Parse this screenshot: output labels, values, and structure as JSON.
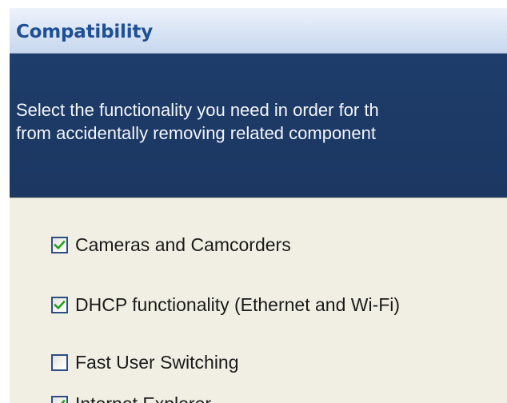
{
  "window": {
    "title": "Compatibility"
  },
  "banner": {
    "line1": "Select the functionality you need in order for th",
    "line2": "from accidentally removing related component"
  },
  "options": [
    {
      "label": "Cameras and Camcorders",
      "checked": true
    },
    {
      "label": "DHCP functionality (Ethernet and Wi-Fi)",
      "checked": true
    },
    {
      "label": "Fast User Switching",
      "checked": false
    },
    {
      "label": "Internet Explorer",
      "checked": true
    }
  ],
  "colors": {
    "banner_bg": "#1f3d6a",
    "title_text": "#1f4f94",
    "panel_bg": "#f1efe3",
    "checkmark": "#21a121",
    "checkbox_border": "#2c4e86"
  },
  "icons": {
    "checkmark": "checkmark-icon"
  }
}
